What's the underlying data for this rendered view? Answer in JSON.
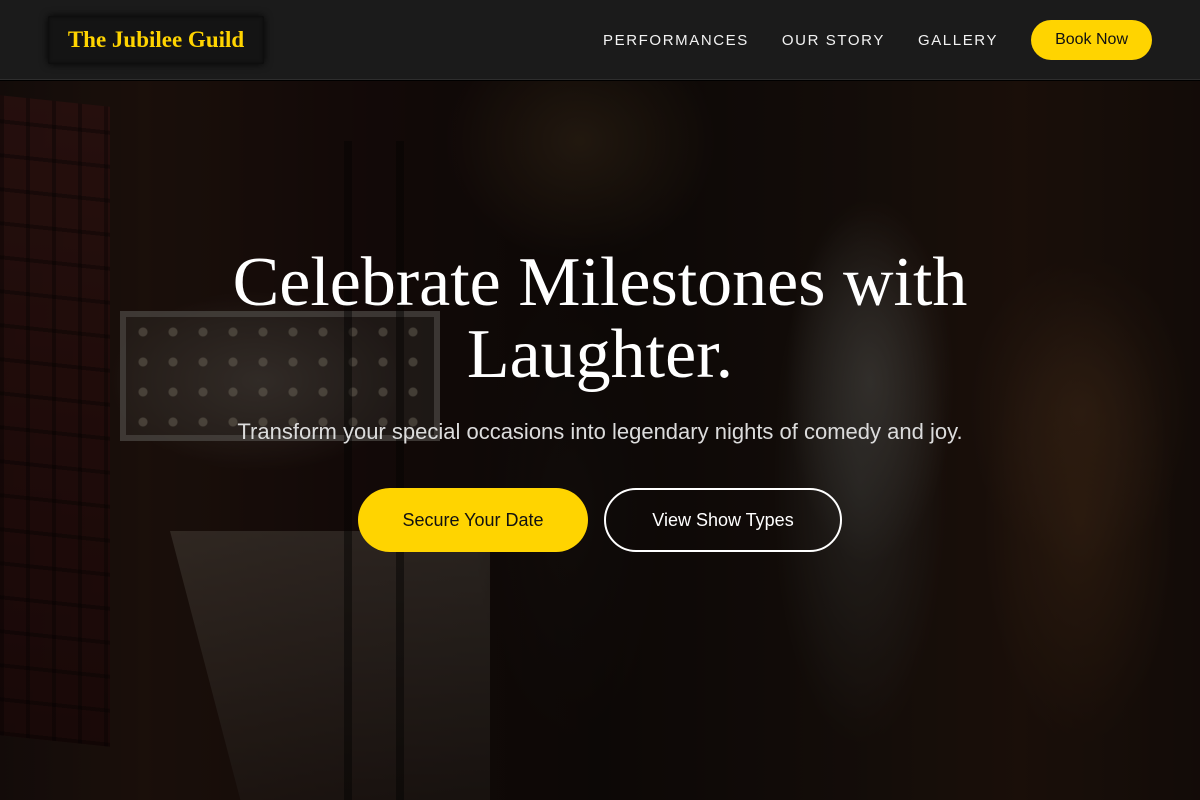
{
  "header": {
    "logo_text": "The Jubilee Guild",
    "nav": [
      {
        "label": "PERFORMANCES"
      },
      {
        "label": "OUR STORY"
      },
      {
        "label": "GALLERY"
      }
    ],
    "cta_label": "Book Now"
  },
  "hero": {
    "title": "Celebrate Milestones with Laughter.",
    "subtitle": "Transform your special occasions into legendary nights of comedy and joy.",
    "primary_button": "Secure Your Date",
    "secondary_button": "View Show Types"
  },
  "colors": {
    "accent": "#FFD400",
    "header_bg": "#1b1b1b",
    "text_light": "#ffffff"
  }
}
